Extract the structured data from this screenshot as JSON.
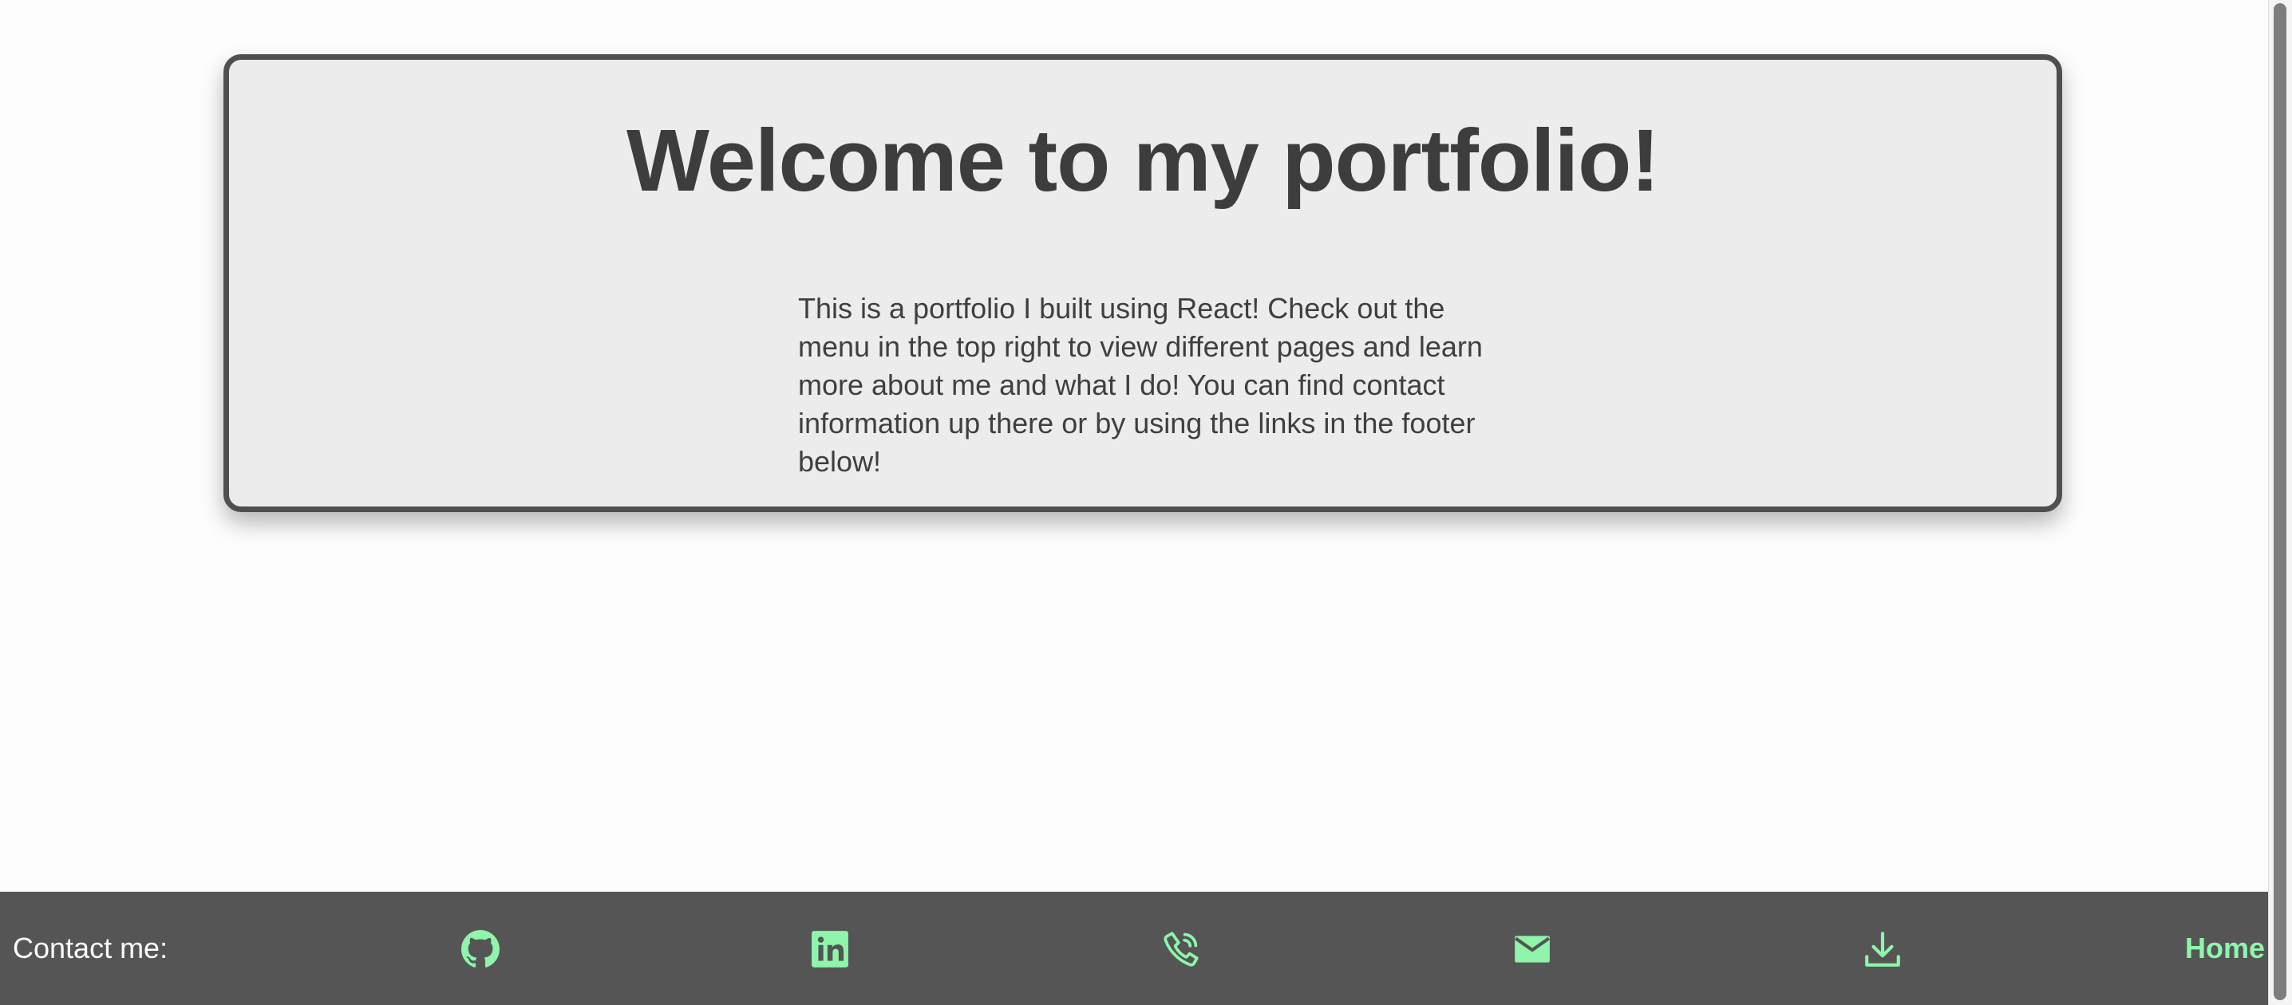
{
  "hero": {
    "title": "Welcome to my portfolio!",
    "text": "This is a portfolio I built using React! Check out the menu in the top right to view different pages and learn more about me and what I do! You can find contact information up there or by using the links in the footer below!"
  },
  "footer": {
    "label": "Contact me:",
    "icons": [
      {
        "name": "github-icon"
      },
      {
        "name": "linkedin-icon"
      },
      {
        "name": "phone-icon"
      },
      {
        "name": "email-icon"
      },
      {
        "name": "download-icon"
      }
    ],
    "nav_label": "Home"
  },
  "colors": {
    "accent": "#8ef5ab",
    "footer_bg": "#555555",
    "card_bg": "#ececec",
    "card_border": "#4f4f4f",
    "text_dark": "#3d3d3d"
  }
}
